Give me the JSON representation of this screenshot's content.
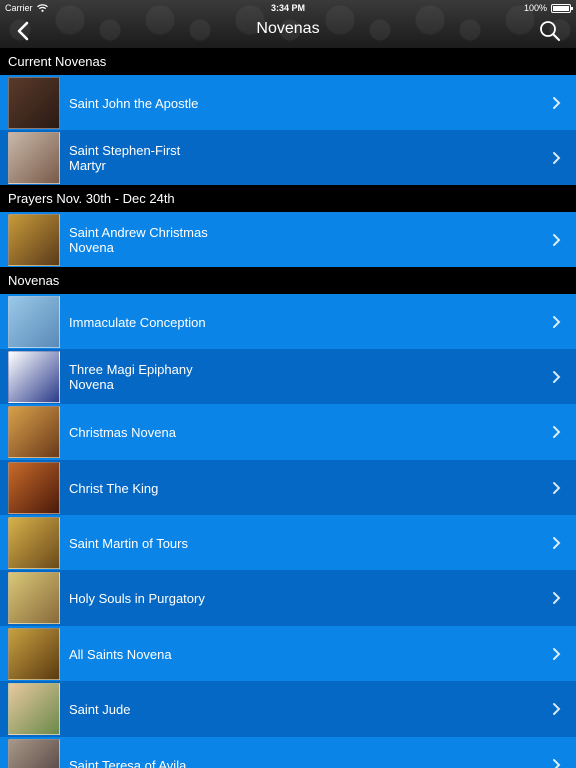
{
  "status": {
    "carrier": "Carrier",
    "time": "3:34 PM",
    "battery": "100%"
  },
  "nav": {
    "title": "Novenas",
    "back_icon": "chevron-left-icon",
    "search_icon": "search-icon"
  },
  "sections": [
    {
      "header": "Current Novenas"
    },
    {
      "header": "Prayers Nov. 30th - Dec 24th"
    },
    {
      "header": "Novenas"
    }
  ],
  "rows": [
    {
      "label": "Saint John the Apostle",
      "thumb_colors": [
        "#5a3a2a",
        "#2a1a14"
      ]
    },
    {
      "label": "Saint Stephen-First Martyr",
      "thumb_colors": [
        "#c8b8a8",
        "#7a5a4a"
      ]
    },
    {
      "label": "Saint Andrew Christmas Novena",
      "thumb_colors": [
        "#c89a3a",
        "#5a3a1a"
      ]
    },
    {
      "label": "Immaculate Conception",
      "thumb_colors": [
        "#9ac8e8",
        "#5a8ab8"
      ]
    },
    {
      "label": "Three Magi Epiphany Novena",
      "thumb_colors": [
        "#ffffff",
        "#2a3a8a"
      ]
    },
    {
      "label": "Christmas Novena",
      "thumb_colors": [
        "#d8a04a",
        "#6a3a1a"
      ]
    },
    {
      "label": "Christ The King",
      "thumb_colors": [
        "#c86a2a",
        "#4a1a0a"
      ]
    },
    {
      "label": "Saint Martin of Tours",
      "thumb_colors": [
        "#d8b04a",
        "#6a4a1a"
      ]
    },
    {
      "label": "Holy Souls in Purgatory",
      "thumb_colors": [
        "#d8c878",
        "#8a6a3a"
      ]
    },
    {
      "label": "All Saints Novena",
      "thumb_colors": [
        "#c8a040",
        "#5a3a10"
      ]
    },
    {
      "label": "Saint Jude",
      "thumb_colors": [
        "#e8c8a0",
        "#6a8a4a"
      ]
    },
    {
      "label": "Saint Teresa of Avila",
      "thumb_colors": [
        "#a89888",
        "#4a3a3a"
      ]
    }
  ]
}
